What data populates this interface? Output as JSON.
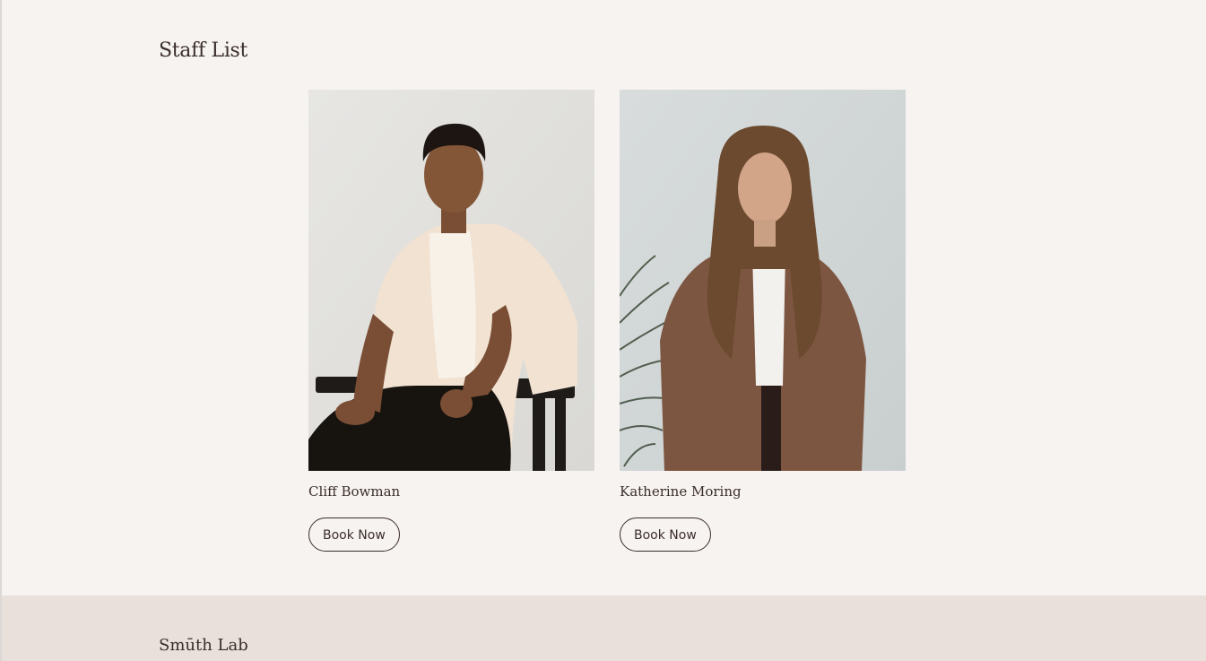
{
  "section": {
    "title": "Staff List"
  },
  "staff": [
    {
      "name": "Cliff Bowman",
      "button_label": "Book Now",
      "photo_icon": "staff-photo-cliff"
    },
    {
      "name": "Katherine Moring",
      "button_label": "Book Now",
      "photo_icon": "staff-photo-katherine"
    }
  ],
  "footer": {
    "brand": "Smūth Lab"
  },
  "colors": {
    "background": "#f7f3f0",
    "footer_background": "#e9dfdb",
    "text": "#3a2e2b"
  }
}
